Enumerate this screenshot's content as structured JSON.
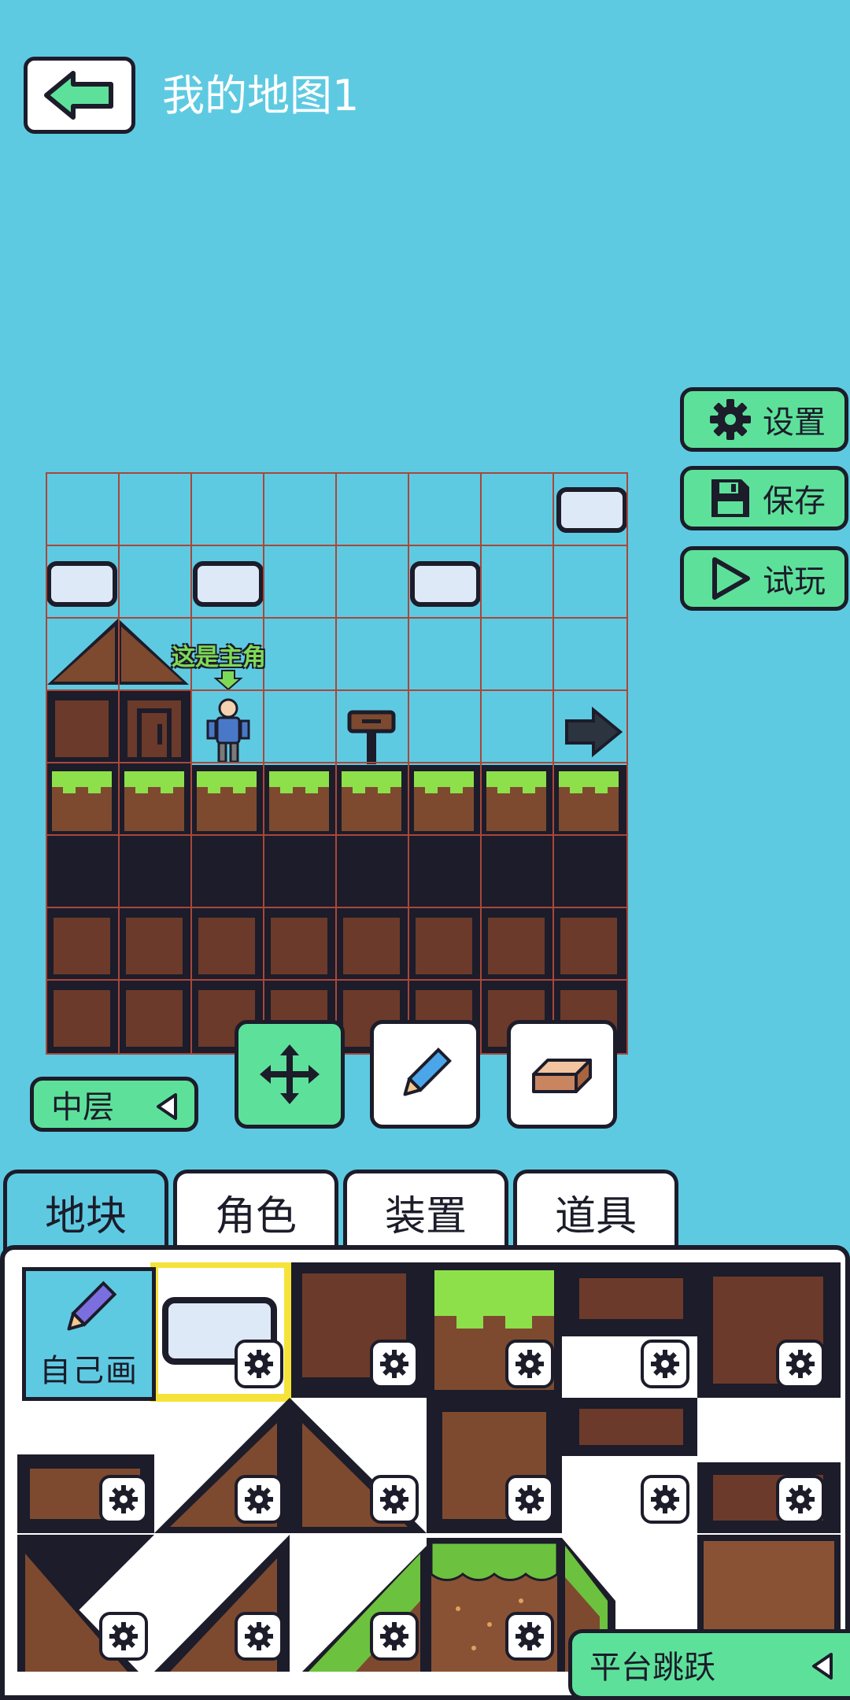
{
  "header": {
    "title": "我的地图1"
  },
  "side_buttons": {
    "settings": "设置",
    "save": "保存",
    "play": "试玩"
  },
  "map": {
    "player_hint": "这是主角",
    "columns": 8,
    "rows": 8
  },
  "tools": {
    "layer": "中层"
  },
  "tabs": [
    {
      "label": "地块",
      "active": true
    },
    {
      "label": "角色",
      "active": false
    },
    {
      "label": "装置",
      "active": false
    },
    {
      "label": "道具",
      "active": false
    }
  ],
  "palette": {
    "draw_own": "自己画"
  },
  "game_type": "平台跳跃",
  "colors": {
    "sky": "#5ecae2",
    "accent_green": "#5de19a",
    "dirt": "#6b3a2a",
    "grass": "#7ed957",
    "outline": "#1c1c2a",
    "grid_line": "#a8473a"
  }
}
